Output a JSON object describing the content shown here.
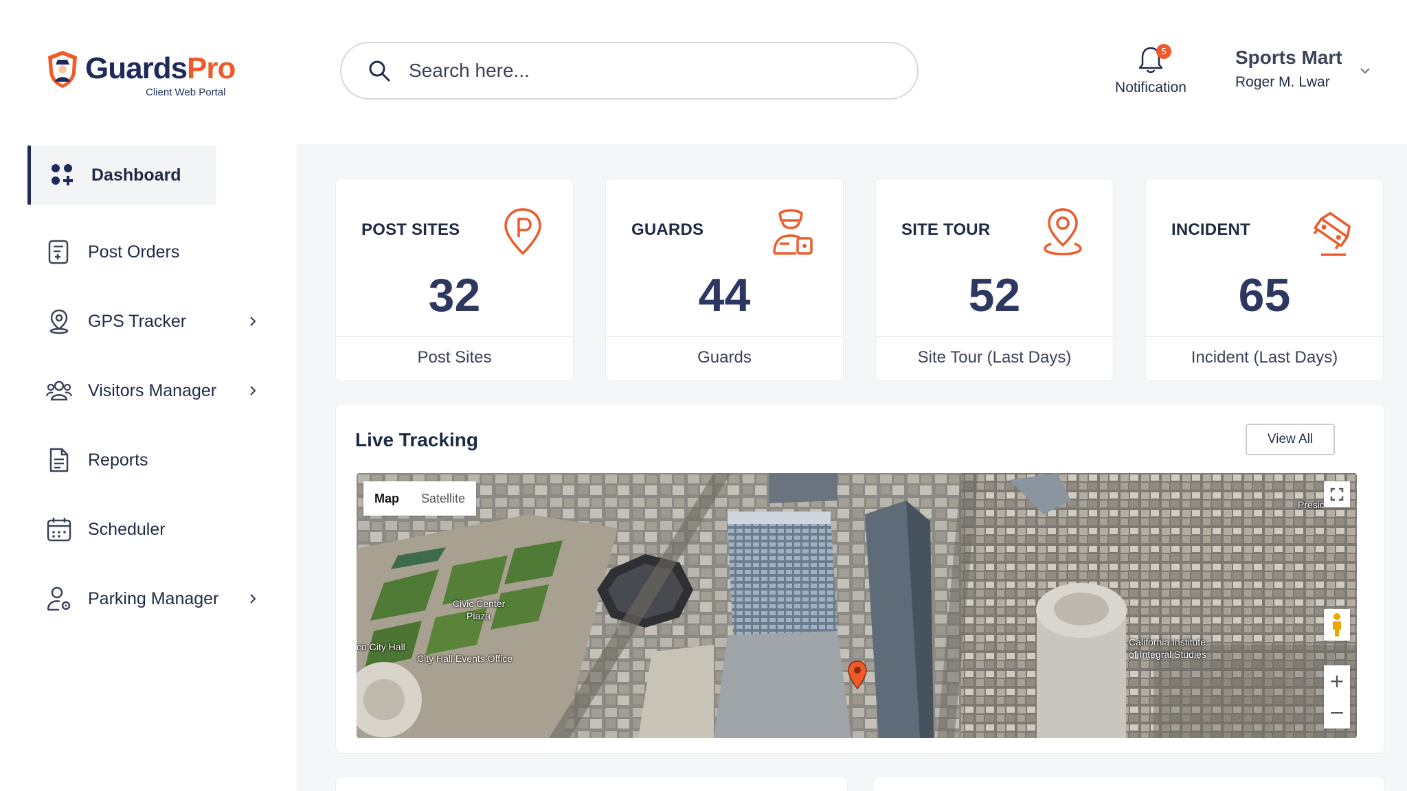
{
  "brand": {
    "name_part1": "Guards",
    "name_part2": "Pro",
    "subtitle": "Client Web Portal",
    "primary_color": "#1f2a5a",
    "accent_color": "#ef5a2a"
  },
  "search": {
    "placeholder": "Search here..."
  },
  "notification": {
    "label": "Notification",
    "count": "5"
  },
  "user": {
    "company": "Sports Mart",
    "name": "Roger M. Lwar"
  },
  "sidebar": {
    "items": [
      {
        "label": "Dashboard",
        "icon": "dashboard-grid-icon",
        "active": true
      },
      {
        "label": "Post Orders",
        "icon": "post-orders-icon"
      },
      {
        "label": "GPS Tracker",
        "icon": "gps-pin-icon",
        "has_submenu": true
      },
      {
        "label": "Visitors Manager",
        "icon": "visitors-icon",
        "has_submenu": true
      },
      {
        "label": "Reports",
        "icon": "document-icon"
      },
      {
        "label": "Scheduler",
        "icon": "calendar-icon"
      },
      {
        "label": "Parking Manager",
        "icon": "parking-user-icon",
        "has_submenu": true
      }
    ]
  },
  "stats": [
    {
      "title": "POST SITES",
      "value": "32",
      "label": "Post Sites",
      "icon": "parking-pin-icon"
    },
    {
      "title": "GUARDS",
      "value": "44",
      "label": "Guards",
      "icon": "guard-icon"
    },
    {
      "title": "SITE TOUR",
      "value": "52",
      "label": "Site Tour (Last Days)",
      "icon": "location-pin-icon"
    },
    {
      "title": "INCIDENT",
      "value": "65",
      "label": "Incident (Last Days)",
      "icon": "car-crash-icon"
    }
  ],
  "tracking": {
    "title": "Live Tracking",
    "view_all": "View All",
    "map_type": {
      "map": "Map",
      "satellite": "Satellite",
      "selected": "Map"
    },
    "labels": {
      "civic_center": "Civic Center",
      "plaza": "Plaza",
      "city_hall": "co City Hall",
      "city_hall_events": "City Hall Events Office",
      "california_institute": "California Institute",
      "integral_studies": "of Integral Studies",
      "presidio": "Presic"
    }
  }
}
